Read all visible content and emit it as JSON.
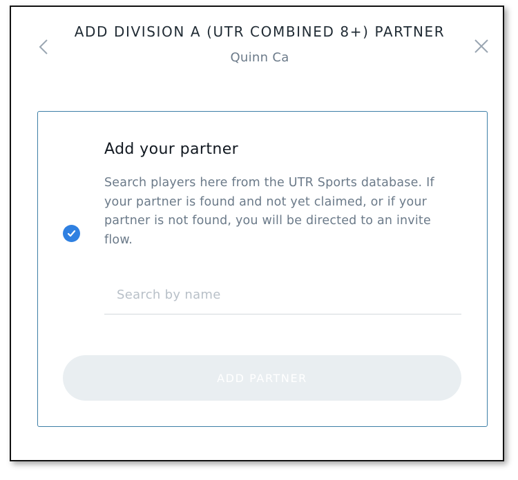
{
  "modal": {
    "title": "ADD DIVISION A (UTR COMBINED 8+) PARTNER",
    "subtitle": "Quinn Ca",
    "back_icon": "chevron-left-icon",
    "close_icon": "close-icon"
  },
  "card": {
    "heading": "Add your partner",
    "description": "Search players here from the UTR Sports database. If your partner is found and not yet claimed, or if your partner is not found, you will be directed to an invite flow.",
    "selected": true,
    "check_icon": "check-circle-icon"
  },
  "search": {
    "value": "",
    "placeholder": "Search by name"
  },
  "actions": {
    "add_partner_label": "ADD PARTNER",
    "add_partner_enabled": false
  },
  "colors": {
    "accent": "#2f80e1",
    "card_border": "#3c7ea6",
    "title": "#1f2a33",
    "muted_text": "#6b7a89",
    "disabled_button": "#e9eef1"
  }
}
